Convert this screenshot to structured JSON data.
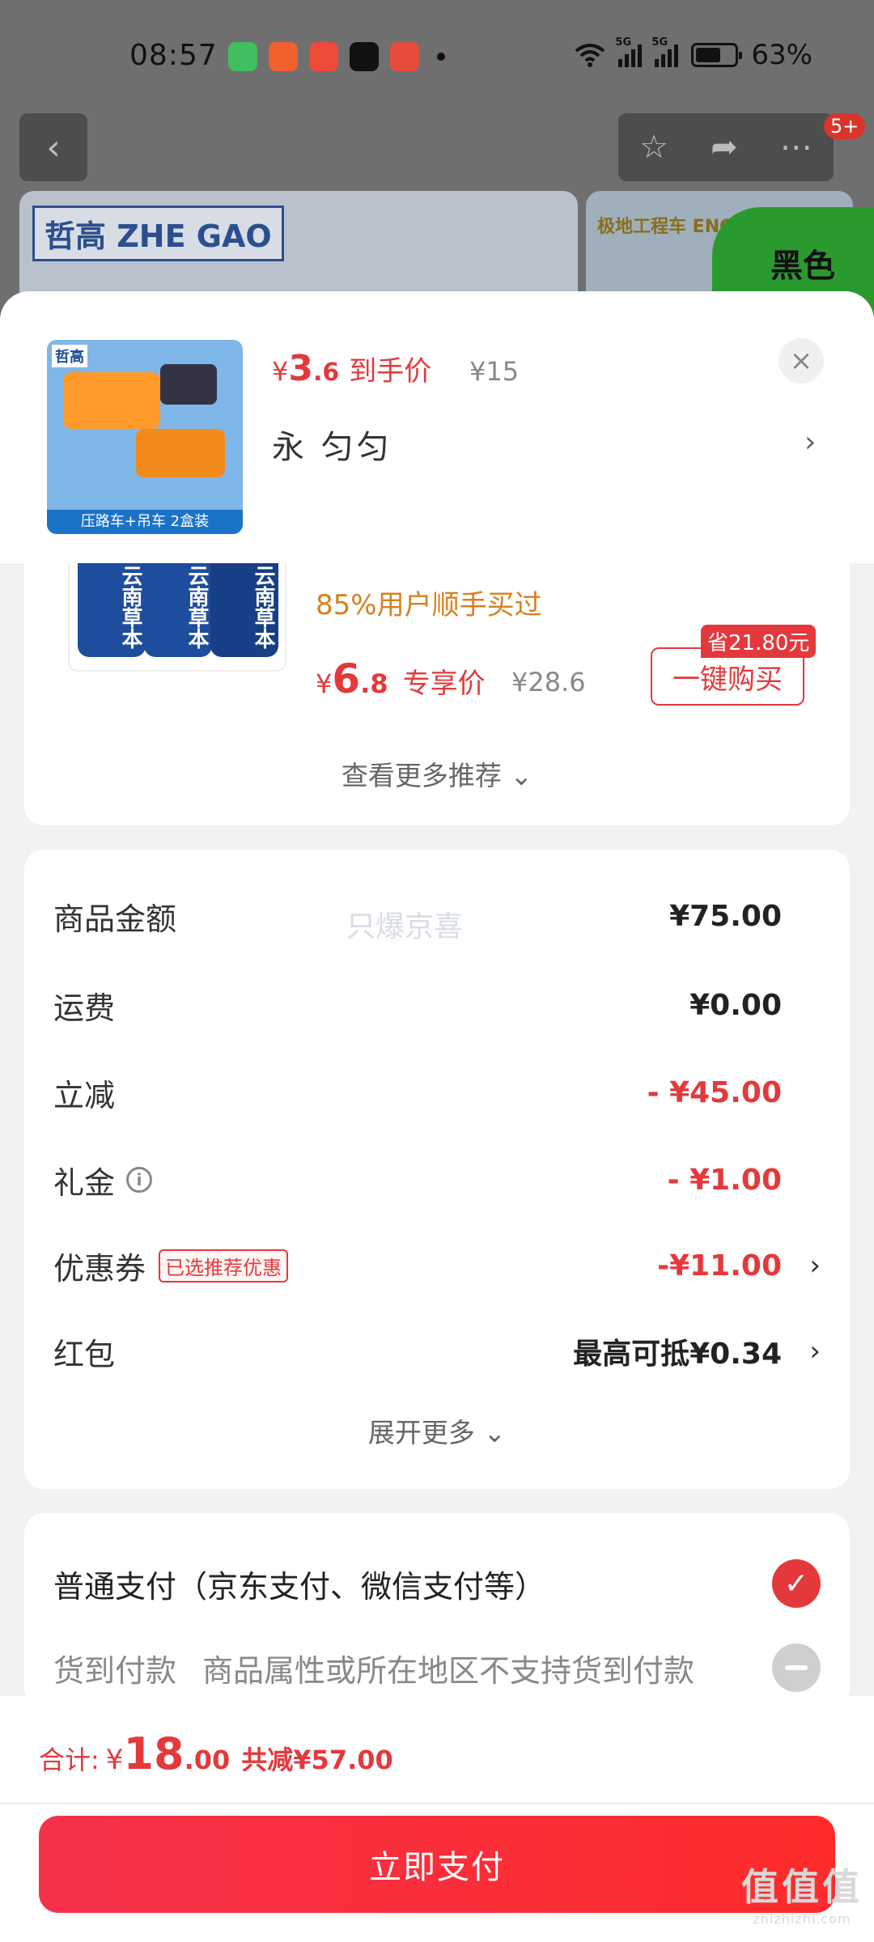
{
  "status_bar": {
    "time": "08:57",
    "battery": "63%",
    "network_tag_1": "5G",
    "network_tag_2": "5G",
    "app_icons": [
      "green-app-icon",
      "orange-app-icon",
      "red-robot-app-icon",
      "tiktok-icon",
      "red-badge-app-icon"
    ]
  },
  "background_page": {
    "brand_logo": "哲高 ZHE GAO",
    "banner_text": "极地工程车 ENGINEERING",
    "green_badge_text": "黑色",
    "notification_badge": "5+",
    "icons": [
      "back-arrow-icon",
      "star-icon",
      "share-icon",
      "more-icon"
    ]
  },
  "sheet_header": {
    "price_currency": "¥",
    "price_int": "3",
    "price_dec": ".6",
    "price_label": "到手价",
    "original_price": "¥15",
    "spec": "永 匀匀",
    "close_icon": "×",
    "chevron": "›",
    "thumb_brand": "哲高",
    "thumb_caption": "压路车+吊车 2盒装"
  },
  "recommendation": {
    "tube_text": "云南草本",
    "subtitle": "85%用户顺手买过",
    "price_currency": "¥",
    "price_int": "6",
    "price_dec": ".8",
    "price_label": "专享价",
    "original_price": "¥28.6",
    "save_tag": "省21.80元",
    "buy_label": "一键购买",
    "more_label": "查看更多推荐 ⌄"
  },
  "fees": {
    "watermark": "只爆京喜",
    "rows": [
      {
        "label": "商品金额",
        "value": "¥75.00"
      },
      {
        "label": "运费",
        "value": "¥0.00"
      },
      {
        "label": "立减",
        "value": "- ¥45.00"
      },
      {
        "label": "礼金",
        "value": "- ¥1.00"
      },
      {
        "label": "优惠券",
        "value": "-¥11.00",
        "tag": "已选推荐优惠"
      },
      {
        "label": "红包",
        "value": "最高可抵¥0.34"
      }
    ],
    "info_icon": "i",
    "chevron": "›",
    "more_label": "展开更多 ⌄"
  },
  "payment": {
    "normal_label": "普通支付（京东支付、微信支付等）",
    "cod_label": "货到付款",
    "cod_note": "商品属性或所在地区不支持货到付款",
    "check_icon": "✓"
  },
  "bottom_bar": {
    "total_label": "合计:",
    "currency": "¥",
    "total_int": "18",
    "total_dec": ".00",
    "save_text": "共减¥57.00",
    "pay_button": "立即支付",
    "corner_mark_big": "值值值",
    "corner_mark_small": "zhizhizhi.com"
  },
  "colors": {
    "accent_red": "#e4393c",
    "orange_text": "#d9801c",
    "green_badge": "#2b9a2e"
  }
}
